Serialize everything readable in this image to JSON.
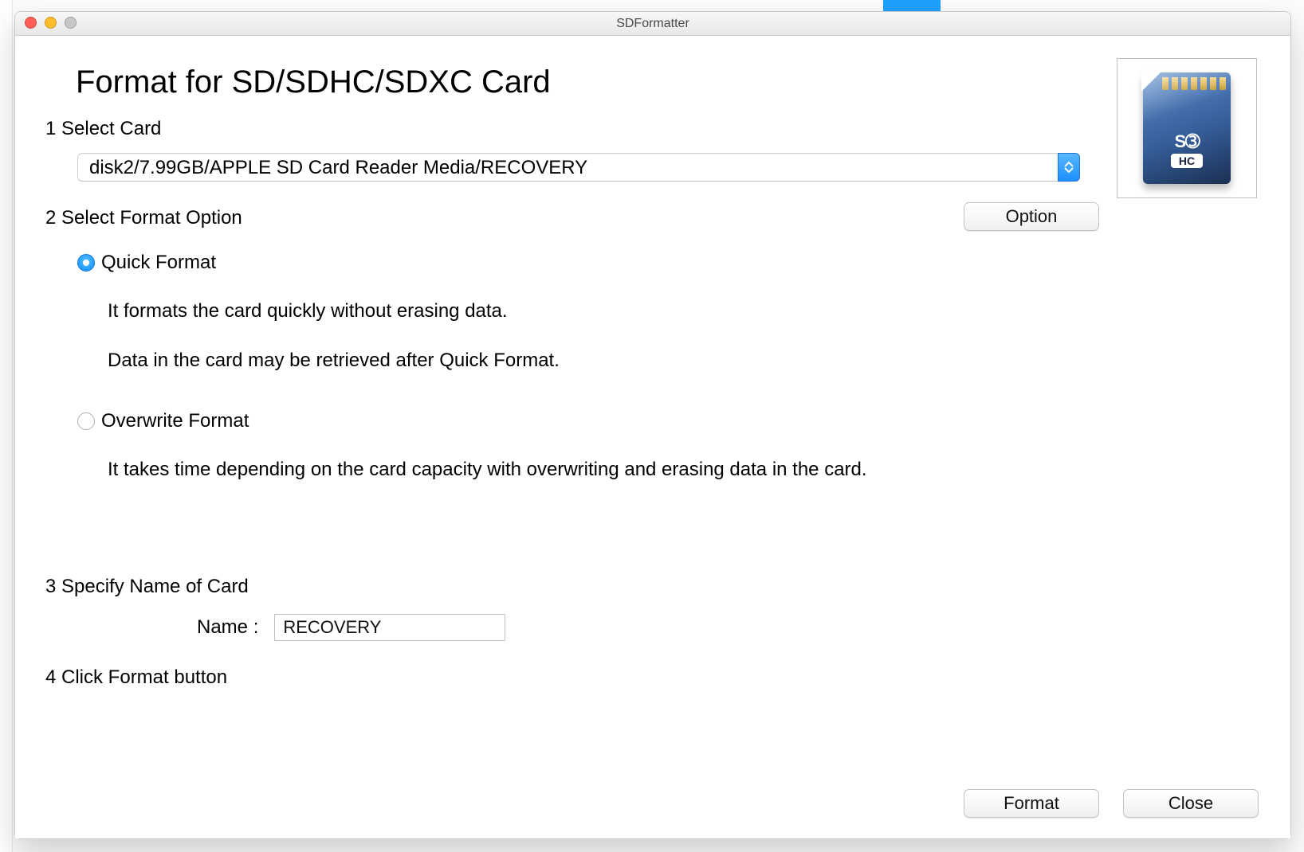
{
  "window_title": "SDFormatter",
  "heading": "Format for SD/SDHC/SDXC Card",
  "steps": {
    "s1": "1 Select Card",
    "s2": "2 Select Format Option",
    "s3": "3 Specify Name of Card",
    "s4": "4 Click Format button"
  },
  "card_select": {
    "value": "disk2/7.99GB/APPLE SD Card Reader Media/RECOVERY"
  },
  "option_button_label": "Option",
  "formats": {
    "quick": {
      "label": "Quick Format",
      "desc1": "It formats the card quickly without erasing data.",
      "desc2": "Data in the card may be retrieved after Quick Format."
    },
    "overwrite": {
      "label": "Overwrite Format",
      "desc1": "It takes time depending on the card capacity with overwriting and erasing data in the card."
    }
  },
  "name_field": {
    "label": "Name :",
    "value": "RECOVERY"
  },
  "footer": {
    "format": "Format",
    "close": "Close"
  },
  "sd_icon": {
    "sd": "S➂",
    "hc": "HC"
  }
}
